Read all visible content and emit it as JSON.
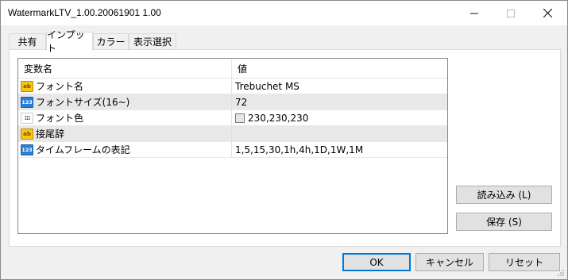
{
  "window": {
    "title": "WatermarkLTV_1.00.20061901 1.00",
    "minimize_glyph": "—",
    "maximize_glyph": "☐",
    "close_glyph": "✕"
  },
  "tabs": [
    {
      "label": "共有",
      "active": false
    },
    {
      "label": "インプット",
      "active": true
    },
    {
      "label": "カラー",
      "active": false
    },
    {
      "label": "表示選択",
      "active": false
    }
  ],
  "grid": {
    "headers": {
      "name": "変数名",
      "value": "値"
    },
    "rows": [
      {
        "icon": "ab-icon",
        "icon_text": "ab",
        "name": "フォント名",
        "value": "Trebuchet MS",
        "shaded": false
      },
      {
        "icon": "number-icon",
        "icon_text": "123",
        "name": "フォントサイズ(16~)",
        "value": "72",
        "shaded": true
      },
      {
        "icon": "color-icon",
        "icon_text": "",
        "name": "フォント色",
        "value": "230,230,230",
        "swatch": "#e6e6e6",
        "shaded": false
      },
      {
        "icon": "ab-icon",
        "icon_text": "ab",
        "name": "接尾辞",
        "value": "",
        "shaded": true
      },
      {
        "icon": "number-icon",
        "icon_text": "123",
        "name": "タイムフレームの表記",
        "value": "1,5,15,30,1h,4h,1D,1W,1M",
        "shaded": false
      }
    ]
  },
  "side_buttons": {
    "load": "読み込み (L)",
    "save": "保存 (S)"
  },
  "footer_buttons": {
    "ok": "OK",
    "cancel": "キャンセル",
    "reset": "リセット"
  },
  "colors": {
    "accent": "#0078d7",
    "ab_icon": "#f5c518",
    "number_icon": "#2d7fd6",
    "row_shade": "#e8e8e8"
  }
}
